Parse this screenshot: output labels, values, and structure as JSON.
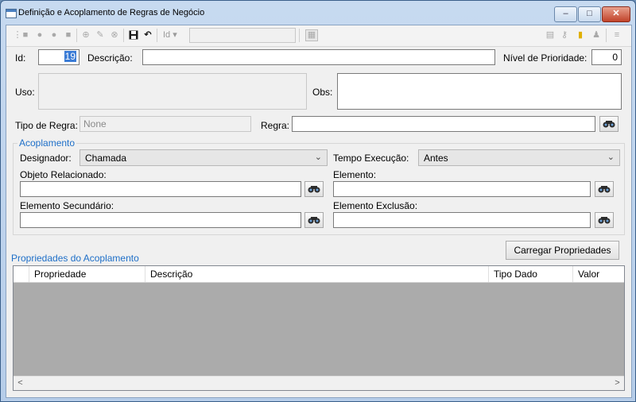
{
  "window": {
    "title": "Definição e Acoplamento de Regras de Negócio",
    "minimize": "–",
    "maximize": "□",
    "close": "✕"
  },
  "toolbar": {
    "id_combo_label": "Id",
    "id_combo_arrow": "▾",
    "search_value": ""
  },
  "form": {
    "id_label": "Id:",
    "id_value": "19",
    "descricao_label": "Descrição:",
    "descricao_value": "",
    "prioridade_label": "Nível de Prioridade:",
    "prioridade_value": "0",
    "uso_label": "Uso:",
    "obs_label": "Obs:",
    "tipo_regra_label": "Tipo de Regra:",
    "tipo_regra_value": "None",
    "regra_label": "Regra:",
    "regra_value": ""
  },
  "acoplamento": {
    "title": "Acoplamento",
    "designador_label": "Designador:",
    "designador_value": "Chamada",
    "tempo_label": "Tempo Execução:",
    "tempo_value": "Antes",
    "objeto_label": "Objeto Relacionado:",
    "elemento_label": "Elemento:",
    "secundario_label": "Elemento Secundário:",
    "exclusao_label": "Elemento Exclusão:"
  },
  "propriedades": {
    "title": "Propriedades do Acoplamento",
    "load_button": "Carregar Propriedades",
    "columns": [
      "Propriedade",
      "Descrição",
      "Tipo Dado",
      "Valor"
    ]
  },
  "scroll": {
    "left": "<",
    "right": ">"
  },
  "colors": {
    "accent": "#1e6fc8",
    "grid_bg": "#ababab"
  },
  "icons": [
    "binoculars-icon",
    "save-icon",
    "undo-icon",
    "window-icon"
  ]
}
